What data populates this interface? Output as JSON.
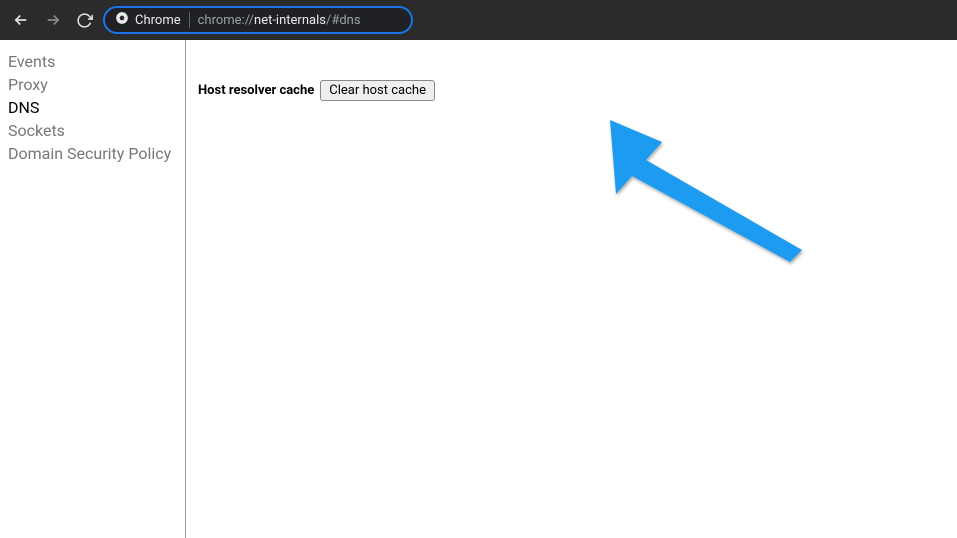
{
  "toolbar": {
    "chrome_label": "Chrome",
    "url_prefix": "chrome://",
    "url_host": "net-internals",
    "url_suffix": "/#dns"
  },
  "sidebar": {
    "items": [
      {
        "label": "Events",
        "active": false
      },
      {
        "label": "Proxy",
        "active": false
      },
      {
        "label": "DNS",
        "active": true
      },
      {
        "label": "Sockets",
        "active": false
      },
      {
        "label": "Domain Security Policy",
        "active": false
      }
    ]
  },
  "main": {
    "section_label": "Host resolver cache",
    "button_label": "Clear host cache"
  },
  "annotation": {
    "arrow_color": "#1e9bf0"
  }
}
